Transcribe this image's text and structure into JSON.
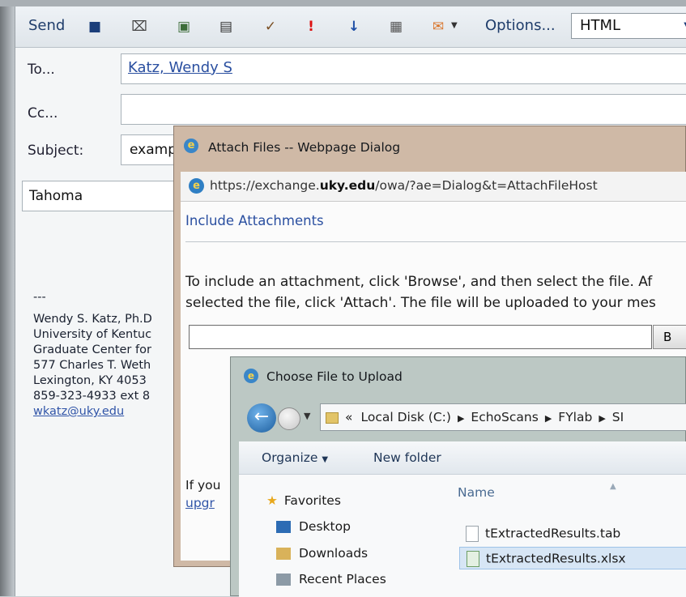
{
  "compose": {
    "toolbar": {
      "send": "Send",
      "options": "Options...",
      "format": "HTML"
    },
    "headers": {
      "to_label": "To...",
      "to_value": "Katz, Wendy S",
      "cc_label": "Cc...",
      "subject_label": "Subject:",
      "subject_value": "examp"
    },
    "font": "Tahoma",
    "signature": {
      "separator": "---",
      "name": "Wendy S. Katz, Ph.D",
      "org": "University of Kentuc",
      "dept": "Graduate Center for",
      "street": "577 Charles T. Weth",
      "city": "Lexington, KY  4053",
      "phone": "859-323-4933 ext 8",
      "email": "wkatz@uky.edu"
    }
  },
  "attach_dialog": {
    "title": "Attach Files -- Webpage Dialog",
    "url_prefix": "https://exchange.",
    "url_domain": "uky.edu",
    "url_rest": "/owa/?ae=Dialog&t=AttachFileHost",
    "section_title": "Include Attachments",
    "instructions_line1": "To include an attachment, click 'Browse', and then select the file. Af",
    "instructions_line2": "selected the file, click 'Attach'. The file will be uploaded to your mes",
    "browse_label": "B",
    "footer_text": "If you",
    "footer_link": "upgr"
  },
  "choose_dialog": {
    "title": "Choose File to Upload",
    "breadcrumb": [
      "Local Disk (C:)",
      "EchoScans",
      "FYlab",
      "SI"
    ],
    "breadcrumb_overflow": "«",
    "organize": "Organize",
    "new_folder": "New folder",
    "nav": {
      "favorites": "Favorites",
      "desktop": "Desktop",
      "downloads": "Downloads",
      "recent": "Recent Places"
    },
    "name_header": "Name",
    "files": [
      "tExtractedResults.tab",
      "tExtractedResults.xlsx"
    ]
  }
}
